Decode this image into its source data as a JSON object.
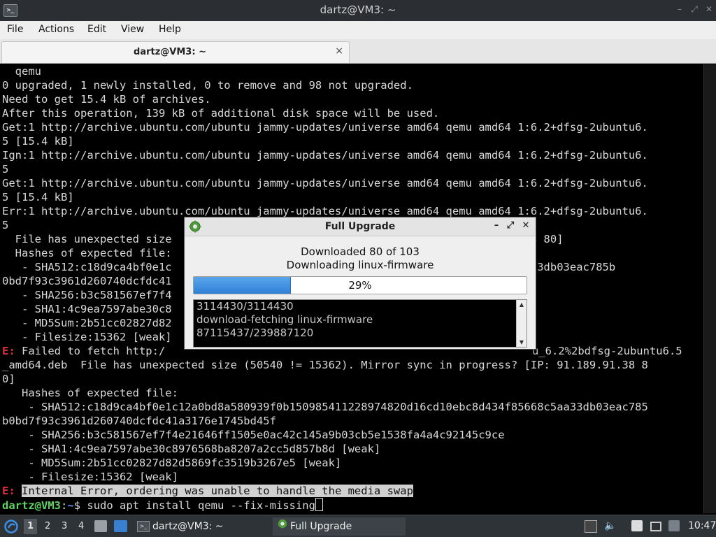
{
  "window": {
    "title": "dartz@VM3: ~",
    "app_icon": ">_"
  },
  "menubar": {
    "items": [
      "File",
      "Actions",
      "Edit",
      "View",
      "Help"
    ]
  },
  "tab": {
    "label": "dartz@VM3: ~",
    "close": "×"
  },
  "terminal": {
    "lines": [
      "  qemu",
      "0 upgraded, 1 newly installed, 0 to remove and 98 not upgraded.",
      "Need to get 15.4 kB of archives.",
      "After this operation, 139 kB of additional disk space will be used.",
      "Get:1 http://archive.ubuntu.com/ubuntu jammy-updates/universe amd64 qemu amd64 1:6.2+dfsg-2ubuntu6.",
      "5 [15.4 kB]",
      "Ign:1 http://archive.ubuntu.com/ubuntu jammy-updates/universe amd64 qemu amd64 1:6.2+dfsg-2ubuntu6.",
      "5",
      "Get:1 http://archive.ubuntu.com/ubuntu jammy-updates/universe amd64 qemu amd64 1:6.2+dfsg-2ubuntu6.",
      "5 [15.4 kB]",
      "Err:1 http://archive.ubuntu.com/ubuntu jammy-updates/universe amd64 qemu amd64 1:6.2+dfsg-2ubuntu6.",
      "5",
      "  File has unexpected size                                             1.189.91.38 80]",
      "  Hashes of expected file:",
      "   - SHA512:c18d9ca4bf0e1c                                             f85668c5aa33db03eac785b",
      "0bd7f93c3961d260740dcfdc41",
      "   - SHA256:b3c581567ef7f4",
      "   - SHA1:4c9ea7597abe30c8",
      "   - MD5Sum:2b51cc02827d82",
      "   - Filesize:15362 [weak]",
      "",
      "_amd64.deb  File has unexpected size (50540 != 15362). Mirror sync in progress? [IP: 91.189.91.38 8",
      "0]",
      "   Hashes of expected file:",
      "    - SHA512:c18d9ca4bf0e1c12a0bd8a580939f0b150985411228974820d16cd10ebc8d434f85668c5aa33db03eac785",
      "b0bd7f93c3961d260740dcfdc41a3176e1745bd45f",
      "    - SHA256:b3c581567ef7f4e21646ff1505e0ac42c145a9b03cb5e1538fa4a4c92145c9ce",
      "    - SHA1:4c9ea7597abe30c8976568ba8207a2cc5d857b8d [weak]",
      "    - MD5Sum:2b51cc02827d82d5869fc3519b3267e5 [weak]",
      "    - Filesize:15362 [weak]"
    ],
    "fetch_error": {
      "prefix": "E:",
      "left": " Failed to fetch http:/",
      "right": "u_6.2%2bdfsg-2ubuntu6.5"
    },
    "internal_error": {
      "prefix": "E:",
      "message": "Internal Error, ordering was unable to handle the media swap"
    },
    "prompt": {
      "user": "dartz@VM3",
      "sep": ":",
      "path": "~",
      "symbol": "$",
      "command": " sudo apt install qemu --fix-missing"
    }
  },
  "dialog": {
    "title": "Full Upgrade",
    "message1": "Downloaded 80 of 103",
    "message2": "Downloading linux-firmware",
    "progress": {
      "value": 0.29,
      "label": "29%"
    },
    "log_lines": [
      "3114430/3114430",
      "download-fetching linux-firmware",
      "87115437/239887120"
    ],
    "buttons": {
      "minimize": "–",
      "maximize": "⤢",
      "close": "✕"
    }
  },
  "taskbar": {
    "workspaces": [
      "1",
      "2",
      "3",
      "4"
    ],
    "active_workspace": "1",
    "tasks": [
      {
        "label": "dartz@VM3: ~",
        "icon": "terminal-icon"
      },
      {
        "label": "Full Upgrade",
        "icon": "gear-icon"
      }
    ],
    "clock": "10:47"
  },
  "colors": {
    "error_red": "#e0303a",
    "prompt_green": "#5fd35f",
    "prompt_blue": "#6d8df0",
    "progress_blue": "#2f80d6"
  }
}
